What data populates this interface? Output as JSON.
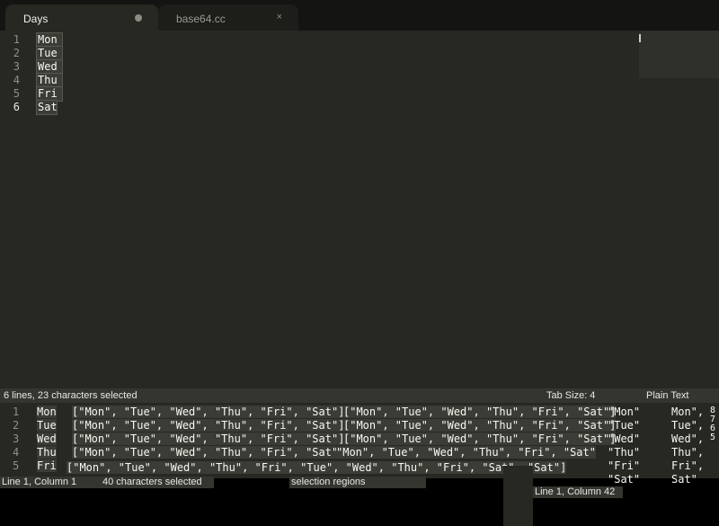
{
  "tabs": [
    {
      "label": "Days",
      "control": "●"
    },
    {
      "label": "base64.cc",
      "control": "×"
    }
  ],
  "editor": {
    "line_numbers": [
      "1",
      "2",
      "3",
      "4",
      "5",
      "6"
    ],
    "lines": [
      "Mon",
      "Tue",
      "Wed",
      "Thu",
      "Fri",
      "Sat"
    ]
  },
  "statusbar": {
    "selection": "6 lines, 23 characters selected",
    "tab_size": "Tab Size: 4",
    "syntax": "Plain Text"
  },
  "glitch": {
    "line_numbers": [
      "1",
      "2",
      "3",
      "4",
      "5"
    ],
    "left_words": [
      "Mon",
      "Tue",
      "Wed",
      "Thu",
      "Fri"
    ],
    "array_text": "[\"Mon\", \"Tue\", \"Wed\", \"Thu\", \"Fri\", \"Sat\"]",
    "array_tail": "\"Mon\", \"Tue\", \"Wed\", \"Thu\", \"Fri\", \"Sat\"",
    "row5_text": "[\"Mon\", \"Tue\", \"Wed\", \"Thu\", \"Fri\", \"Tue\", \"Wed\", \"Thu\", \"Fri\", \"Sat\",   \"Sat\"]",
    "right_column": [
      "\"Mon\"",
      "\"Tue\"",
      "\"Wed\"",
      "\"Thu\"",
      "\"Fri\"",
      "\"Sat\""
    ],
    "far_right_words": [
      "Mon\",",
      "Tue\",",
      "Wed\",",
      "Thu\",",
      "Fri\",",
      "Sat\""
    ],
    "far_right_nums": [
      "8",
      "7",
      "6",
      "5"
    ],
    "status_line_col": "Line 1, Column 1",
    "status_chars": "40 characters selected",
    "status_regions": "selection regions",
    "status_line_col2": "Line 1, Column 42"
  }
}
